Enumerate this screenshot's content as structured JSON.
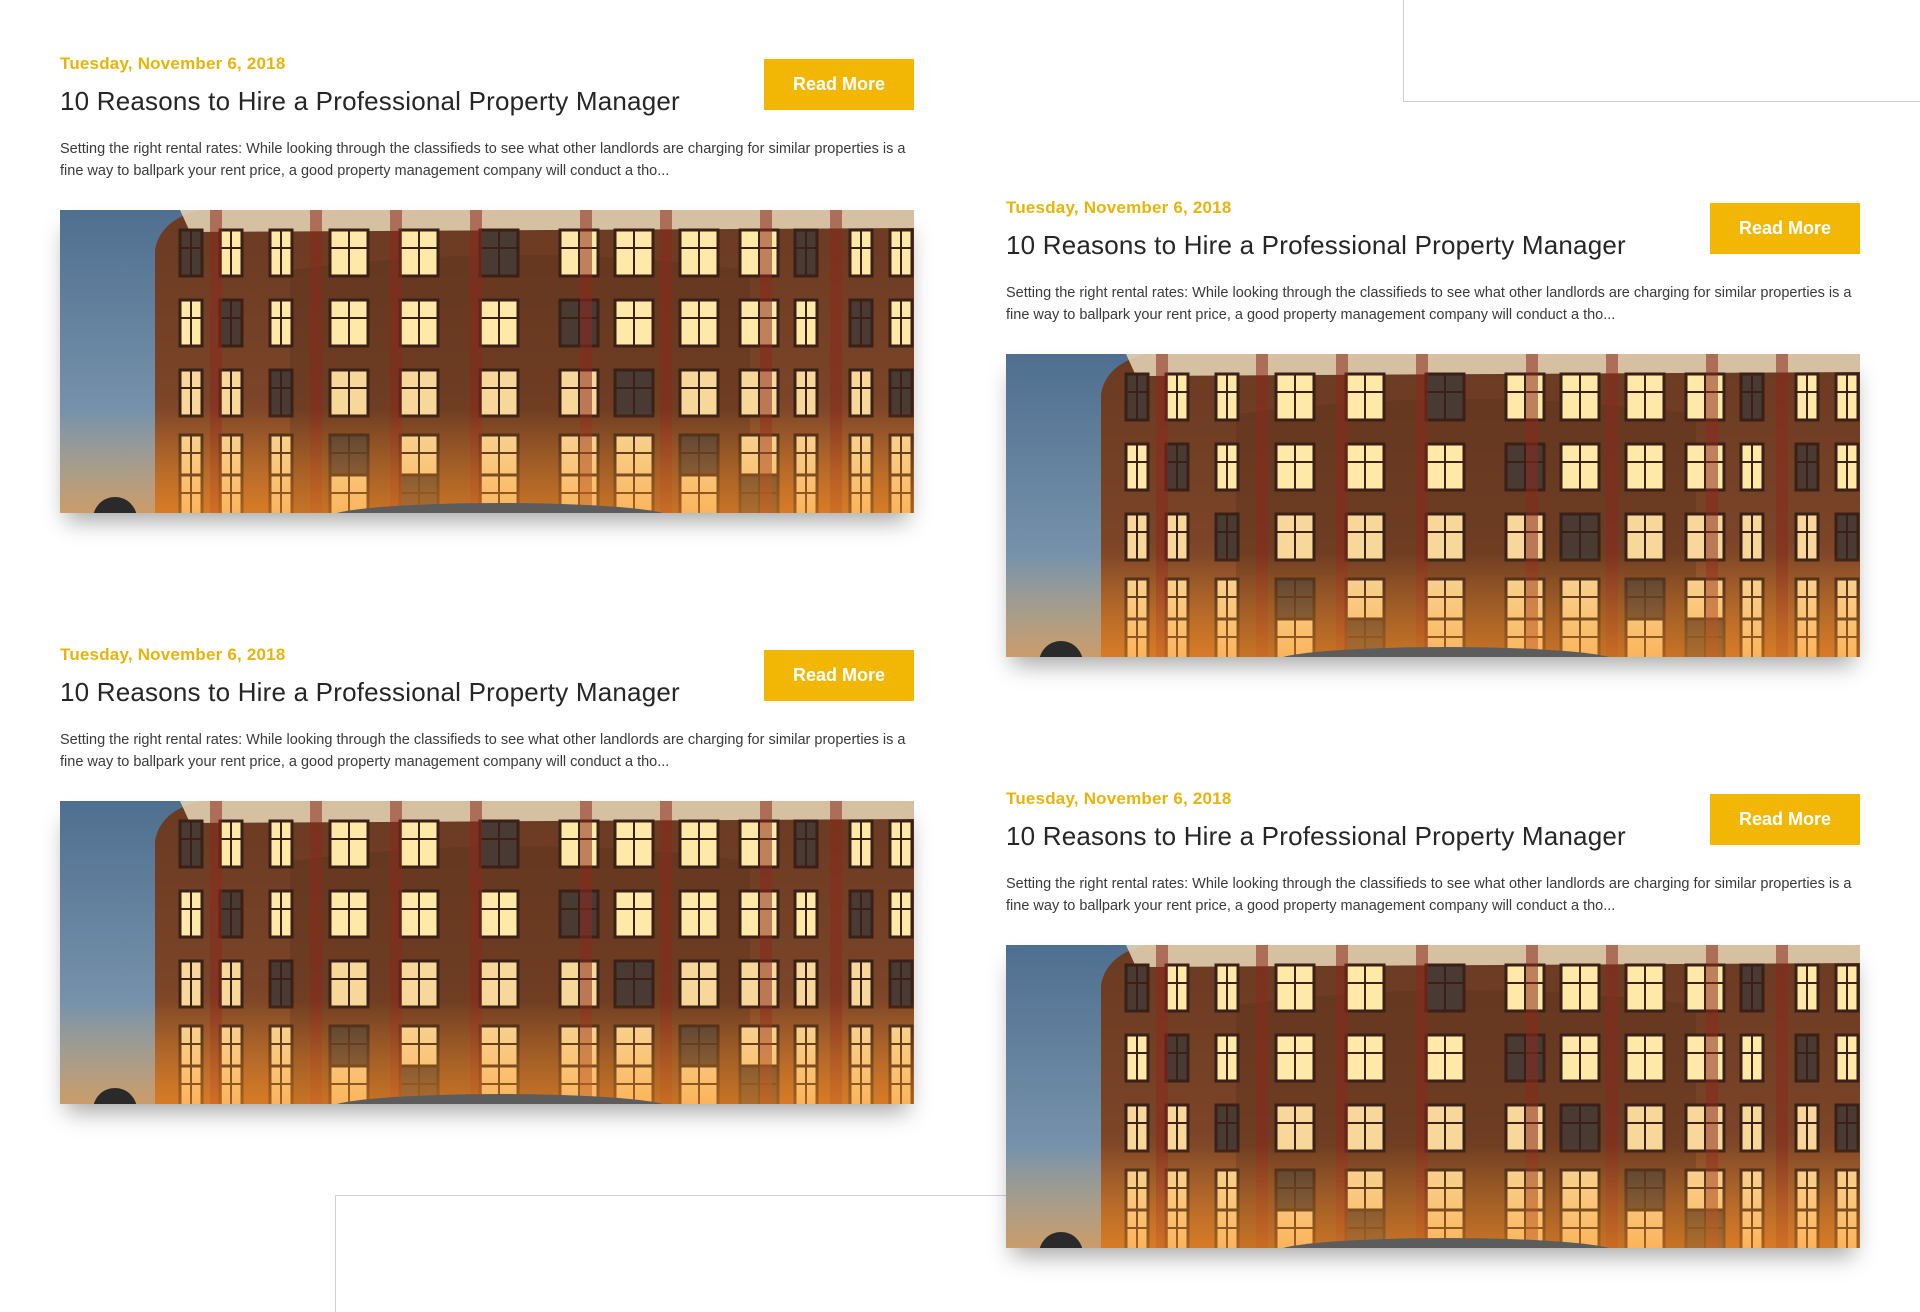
{
  "colors": {
    "accent": "#f2b705",
    "date_text": "#e8b40a",
    "title_text": "#262626"
  },
  "posts": [
    {
      "date": "Tuesday, November 6, 2018",
      "title": "10 Reasons to Hire a Professional Property Manager",
      "excerpt": "Setting the right rental rates: While looking through the classifieds to see what other landlords are charging for similar properties is a fine way to ballpark your rent price, a good property management company will conduct a tho...",
      "button_label": "Read More",
      "image_subject": "brick apartment building at dusk"
    },
    {
      "date": "Tuesday, November 6, 2018",
      "title": "10 Reasons to Hire a Professional Property Manager",
      "excerpt": "Setting the right rental rates: While looking through the classifieds to see what other landlords are charging for similar properties is a fine way to ballpark your rent price, a good property management company will conduct a tho...",
      "button_label": "Read More",
      "image_subject": "brick apartment building at dusk"
    },
    {
      "date": "Tuesday, November 6, 2018",
      "title": "10 Reasons to Hire a Professional Property Manager",
      "excerpt": "Setting the right rental rates: While looking through the classifieds to see what other landlords are charging for similar properties is a fine way to ballpark your rent price, a good property management company will conduct a tho...",
      "button_label": "Read More",
      "image_subject": "brick apartment building at dusk"
    },
    {
      "date": "Tuesday, November 6, 2018",
      "title": "10 Reasons to Hire a Professional Property Manager",
      "excerpt": "Setting the right rental rates: While looking through the classifieds to see what other landlords are charging for similar properties is a fine way to ballpark your rent price, a good property management company will conduct a tho...",
      "button_label": "Read More",
      "image_subject": "brick apartment building at dusk"
    }
  ]
}
